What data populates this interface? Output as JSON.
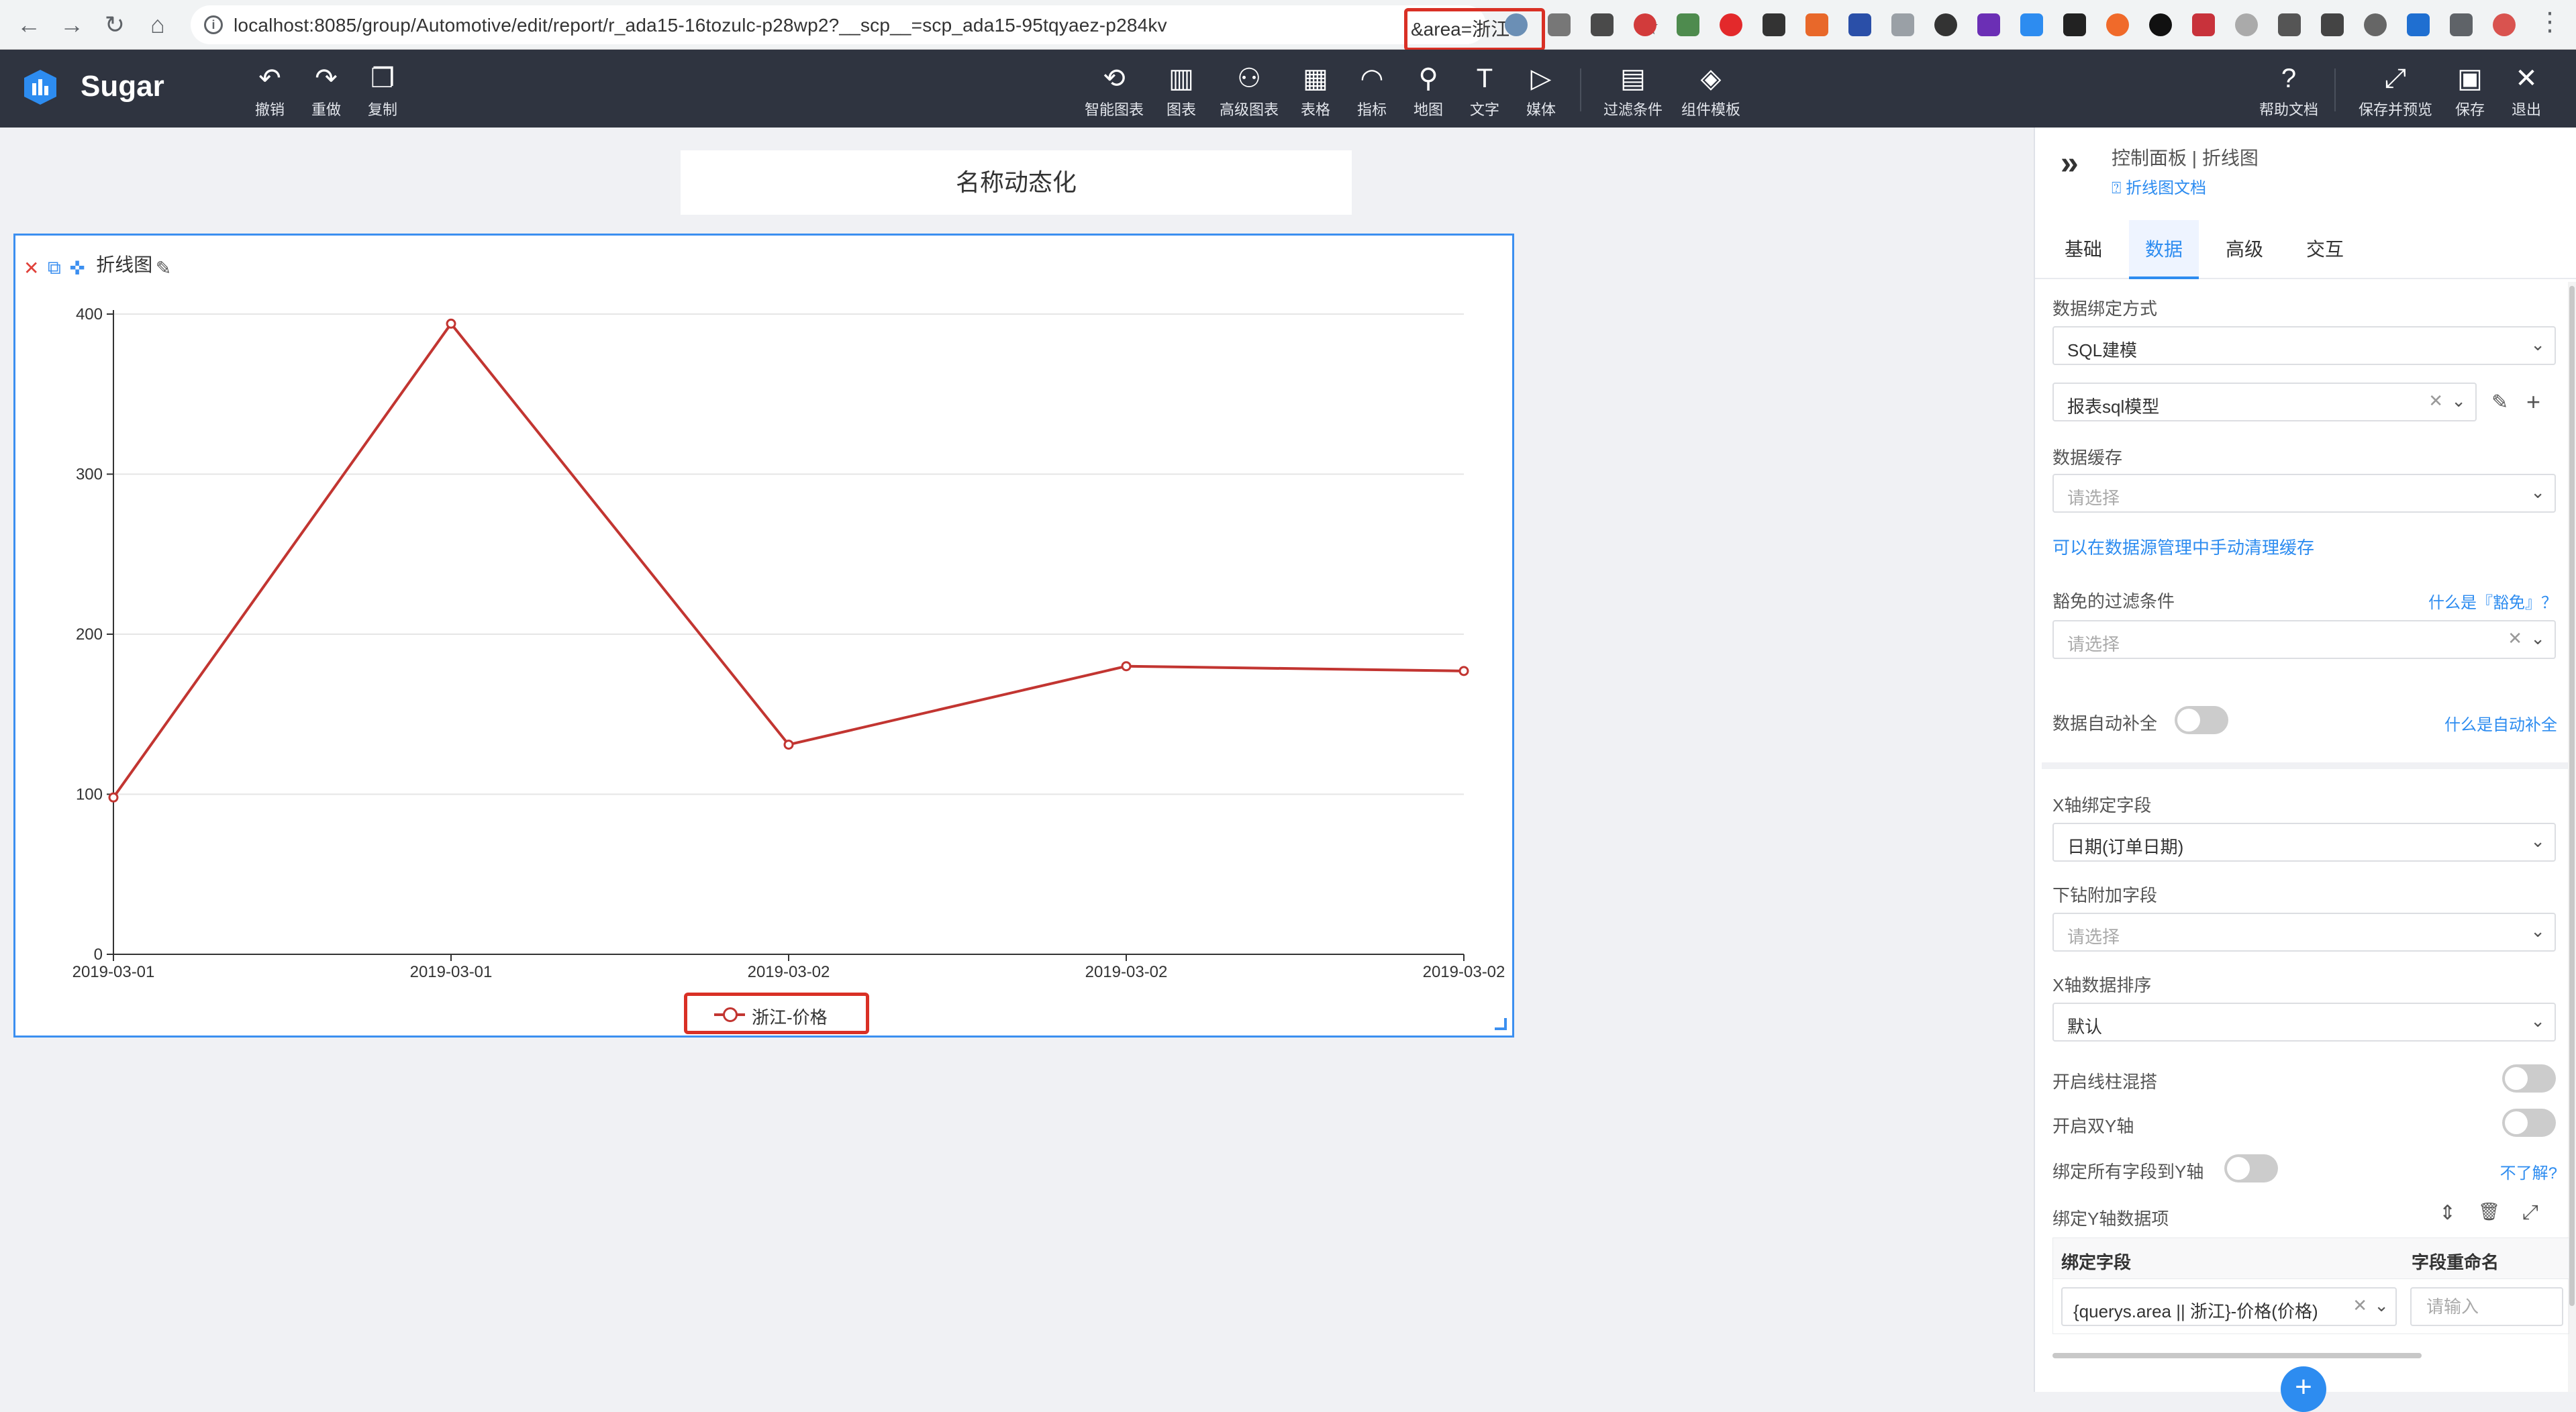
{
  "browser": {
    "url": "localhost:8085/group/Automotive/edit/report/r_ada15-16tozulc-p28wp2?__scp__=scp_ada15-95tqyaez-p284kv",
    "url_highlighted": "&area=浙江",
    "back_icon": "←",
    "forward_icon": "→",
    "reload_icon": "↻",
    "home_icon": "⌂",
    "info_icon": "i",
    "star_icon": "☆",
    "menu_icon": "⋮"
  },
  "app": {
    "name": "Sugar",
    "left_tools": [
      {
        "icon": "↶",
        "label": "撤销"
      },
      {
        "icon": "↷",
        "label": "重做"
      },
      {
        "icon": "❐",
        "label": "复制"
      }
    ],
    "center_tools": [
      {
        "icon": "⟲",
        "label": "智能图表"
      },
      {
        "icon": "▥",
        "label": "图表"
      },
      {
        "icon": "⚇",
        "label": "高级图表"
      },
      {
        "icon": "▦",
        "label": "表格"
      },
      {
        "icon": "◠",
        "label": "指标"
      },
      {
        "icon": "⚲",
        "label": "地图"
      },
      {
        "icon": "T",
        "label": "文字"
      },
      {
        "icon": "▷",
        "label": "媒体"
      },
      {
        "icon": "▤",
        "label": "过滤条件"
      },
      {
        "icon": "◈",
        "label": "组件模板"
      }
    ],
    "right_tools": [
      {
        "icon": "?",
        "label": "帮助文档"
      },
      {
        "icon": "⤢",
        "label": "保存并预览"
      },
      {
        "icon": "▣",
        "label": "保存"
      },
      {
        "icon": "✕",
        "label": "退出"
      }
    ]
  },
  "canvas": {
    "title": "名称动态化",
    "widget": {
      "name": "折线图",
      "close_icon": "✕",
      "copy_icon": "⧉",
      "expand_icon": "✜",
      "edit_icon": "✎"
    }
  },
  "chart_data": {
    "type": "line",
    "categories": [
      "2019-03-01",
      "2019-03-01",
      "2019-03-02",
      "2019-03-02",
      "2019-03-02"
    ],
    "series": [
      {
        "name": "浙江-价格",
        "values": [
          98,
          394,
          131,
          180,
          177
        ],
        "color": "#c23531"
      }
    ],
    "y_ticks": [
      0,
      100,
      200,
      300,
      400
    ],
    "ylim": [
      0,
      400
    ],
    "grid": true,
    "legend_position": "bottom-center"
  },
  "panel": {
    "collapse_icon": "»",
    "title": "控制面板 | 折线图",
    "doc_link": "⍰ 折线图文档",
    "tabs": [
      "基础",
      "数据",
      "高级",
      "交互"
    ],
    "active_tab": "数据",
    "binding_mode_label": "数据绑定方式",
    "binding_mode_value": "SQL建模",
    "model_value": "报表sql模型",
    "cache_label": "数据缓存",
    "cache_placeholder": "请选择",
    "cache_hint": "可以在数据源管理中手动清理缓存",
    "exempt_label": "豁免的过滤条件",
    "exempt_help": "什么是『豁免』？",
    "exempt_placeholder": "请选择",
    "autofill_label": "数据自动补全",
    "autofill_help": "什么是自动补全",
    "x_field_label": "X轴绑定字段",
    "x_field_value": "日期(订单日期)",
    "drill_label": "下钻附加字段",
    "drill_placeholder": "请选择",
    "x_sort_label": "X轴数据排序",
    "x_sort_value": "默认",
    "line_bar_label": "开启线柱混搭",
    "dual_y_label": "开启双Y轴",
    "bind_all_label": "绑定所有字段到Y轴",
    "bind_all_help": "不了解?",
    "y_items_label": "绑定Y轴数据项",
    "table_headers": [
      "绑定字段",
      "字段重命名"
    ],
    "row_field_value": "{querys.area || 浙江}-价格(价格)",
    "row_rename_placeholder": "请输入",
    "add_icon": "+",
    "clear_icon": "✕",
    "chevron_icon": "⌄",
    "pencil_icon": "✎",
    "plus_icon": "+",
    "sort_icon": "⇕",
    "trash_icon": "🗑",
    "expand_icon": "⤢"
  },
  "colors": {
    "header_bg": "#2f3440",
    "accent": "#2d8cf0",
    "highlight": "#d93025",
    "line": "#c23531"
  }
}
